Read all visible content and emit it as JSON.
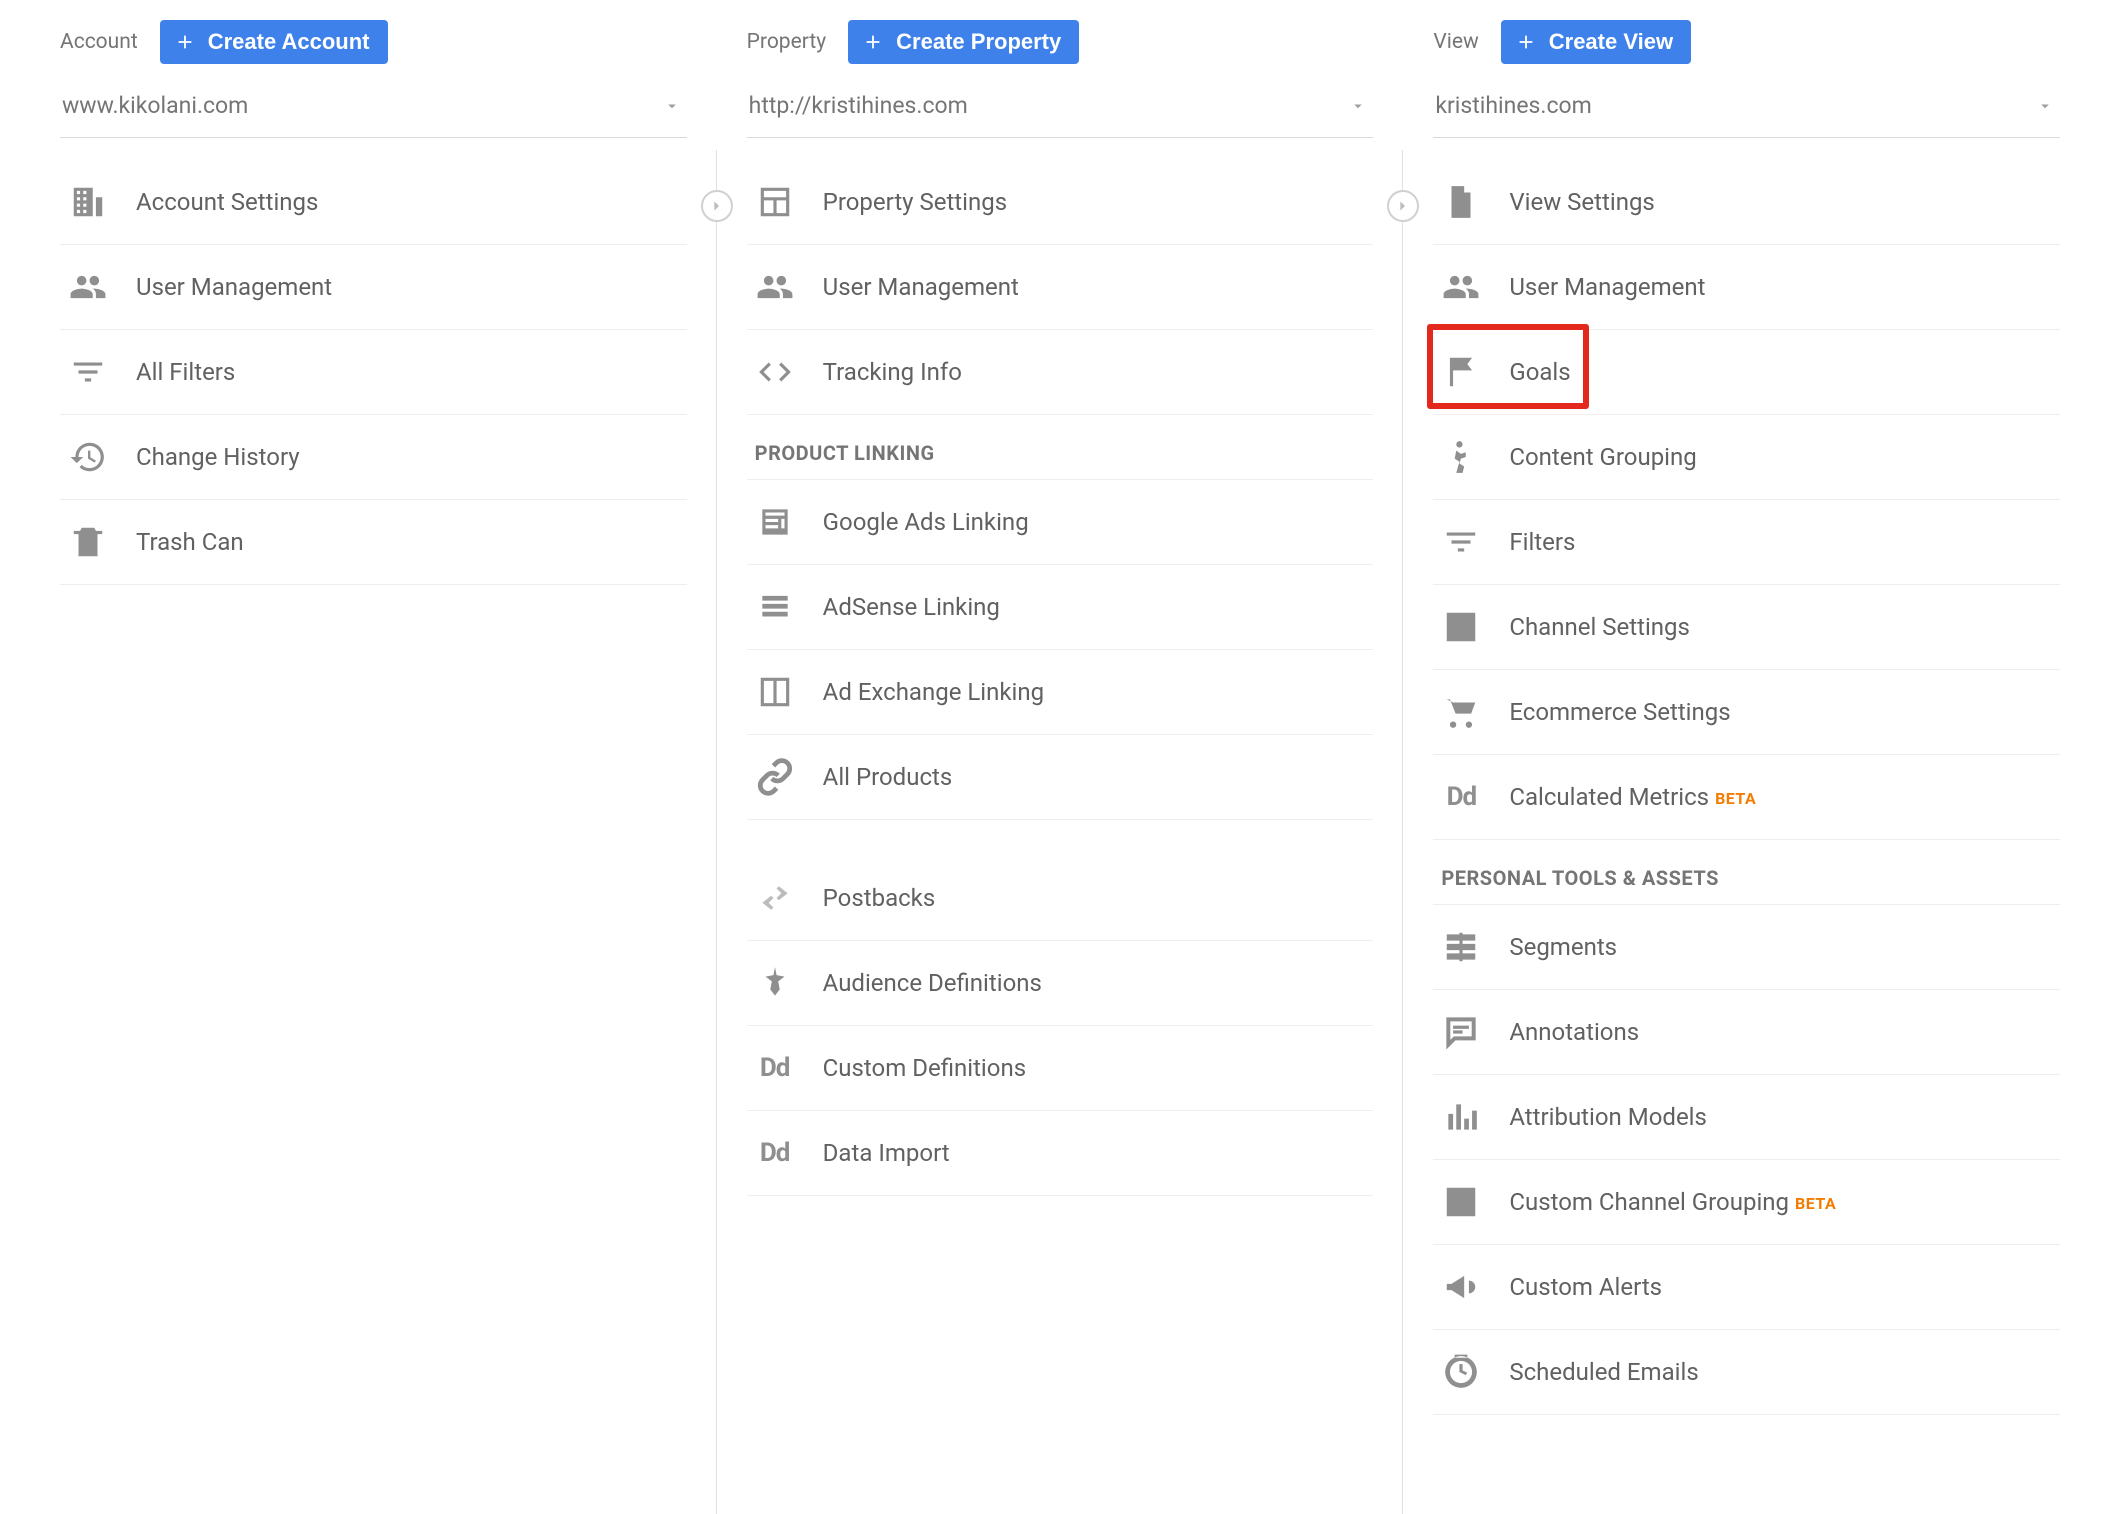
{
  "account": {
    "title": "Account",
    "create_label": "Create Account",
    "selected": "www.kikolani.com",
    "items": [
      {
        "label": "Account Settings"
      },
      {
        "label": "User Management"
      },
      {
        "label": "All Filters"
      },
      {
        "label": "Change History"
      },
      {
        "label": "Trash Can"
      }
    ]
  },
  "property": {
    "title": "Property",
    "create_label": "Create Property",
    "selected": "http://kristihines.com",
    "items_a": [
      {
        "label": "Property Settings"
      },
      {
        "label": "User Management"
      },
      {
        "label": "Tracking Info"
      }
    ],
    "section_a_title": "PRODUCT LINKING",
    "items_b": [
      {
        "label": "Google Ads Linking"
      },
      {
        "label": "AdSense Linking"
      },
      {
        "label": "Ad Exchange Linking"
      },
      {
        "label": "All Products"
      }
    ],
    "items_c": [
      {
        "label": "Postbacks"
      },
      {
        "label": "Audience Definitions"
      },
      {
        "label": "Custom Definitions"
      },
      {
        "label": "Data Import"
      }
    ]
  },
  "view": {
    "title": "View",
    "create_label": "Create View",
    "selected": "kristihines.com",
    "items_a": [
      {
        "label": "View Settings"
      },
      {
        "label": "User Management"
      },
      {
        "label": "Goals"
      },
      {
        "label": "Content Grouping"
      },
      {
        "label": "Filters"
      },
      {
        "label": "Channel Settings"
      },
      {
        "label": "Ecommerce Settings"
      },
      {
        "label": "Calculated Metrics",
        "beta": "BETA"
      }
    ],
    "section_b_title": "PERSONAL TOOLS & ASSETS",
    "items_b": [
      {
        "label": "Segments"
      },
      {
        "label": "Annotations"
      },
      {
        "label": "Attribution Models"
      },
      {
        "label": "Custom Channel Grouping",
        "beta": "BETA"
      },
      {
        "label": "Custom Alerts"
      },
      {
        "label": "Scheduled Emails"
      }
    ]
  }
}
